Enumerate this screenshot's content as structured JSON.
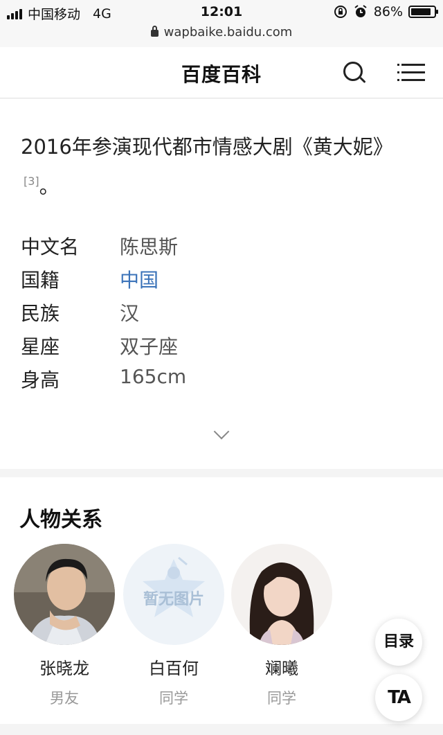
{
  "status_bar": {
    "carrier": "中国移动",
    "network": "4G",
    "time": "12:01",
    "battery": "86%",
    "battery_level": 0.86,
    "url": "wapbaike.baidu.com"
  },
  "header": {
    "logo": "百度百科"
  },
  "intro": {
    "text": "2016年参演现代都市情感大剧《黄大妮》",
    "citation": "[3]",
    "trailing": "。"
  },
  "info": [
    {
      "key": "中文名",
      "value": "陈思斯"
    },
    {
      "key": "国籍",
      "value": "中国"
    },
    {
      "key": "民族",
      "value": "汉"
    },
    {
      "key": "星座",
      "value": "双子座"
    },
    {
      "key": "身高",
      "value": "165cm"
    }
  ],
  "relations": {
    "title": "人物关系",
    "people": [
      {
        "name": "张晓龙",
        "relation": "男友"
      },
      {
        "name": "白百何",
        "relation": "同学",
        "placeholder": "暂无图片"
      },
      {
        "name": "斓曦",
        "relation": "同学"
      }
    ]
  },
  "floating": {
    "toc": "目录",
    "ta": "TA"
  },
  "colors": {
    "link": "#3b73b9",
    "muted": "#999999"
  }
}
